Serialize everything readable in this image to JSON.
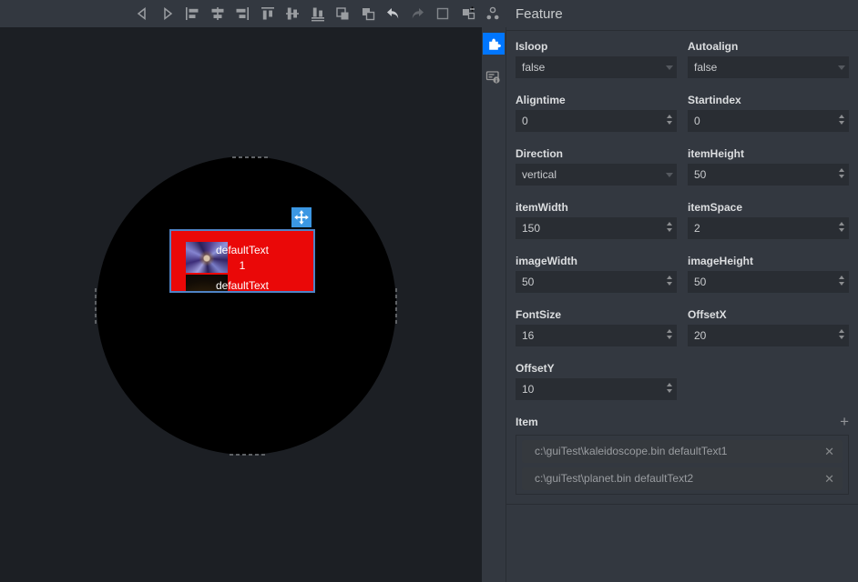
{
  "toolbar": {
    "icons": [
      "nav-back",
      "nav-forward",
      "align-left",
      "align-center-horizontal",
      "align-right",
      "align-top",
      "align-middle-vertical",
      "align-bottom",
      "bring-forward",
      "send-backward",
      "undo",
      "redo",
      "selection-rect",
      "replace",
      "hierarchy"
    ]
  },
  "canvas": {
    "element": {
      "item1_line1": "defaultText",
      "item1_line2": "1",
      "item2_line1": "defaultText",
      "fill_color": "#ea0808",
      "selection_color": "#4f83c5",
      "handle_color": "#3b97e3"
    }
  },
  "side_tabs": {
    "feature_tab_color": "#0076ff"
  },
  "panel": {
    "title": "Feature",
    "fields": [
      {
        "label": "Isloop",
        "type": "select",
        "value": "false"
      },
      {
        "label": "Autoalign",
        "type": "select",
        "value": "false"
      },
      {
        "label": "Aligntime",
        "type": "number",
        "value": "0"
      },
      {
        "label": "Startindex",
        "type": "number",
        "value": "0"
      },
      {
        "label": "Direction",
        "type": "select",
        "value": "vertical"
      },
      {
        "label": "itemHeight",
        "type": "number",
        "value": "50"
      },
      {
        "label": "itemWidth",
        "type": "number",
        "value": "150"
      },
      {
        "label": "itemSpace",
        "type": "number",
        "value": "2"
      },
      {
        "label": "imageWidth",
        "type": "number",
        "value": "50"
      },
      {
        "label": "imageHeight",
        "type": "number",
        "value": "50"
      },
      {
        "label": "FontSize",
        "type": "number",
        "value": "16"
      },
      {
        "label": "OffsetX",
        "type": "number",
        "value": "20"
      },
      {
        "label": "OffsetY",
        "type": "number",
        "value": "10"
      }
    ],
    "item": {
      "label": "Item",
      "add_label": "+",
      "rows": [
        "c:\\guiTest\\kaleidoscope.bin defaultText1",
        "c:\\guiTest\\planet.bin defaultText2"
      ]
    }
  }
}
